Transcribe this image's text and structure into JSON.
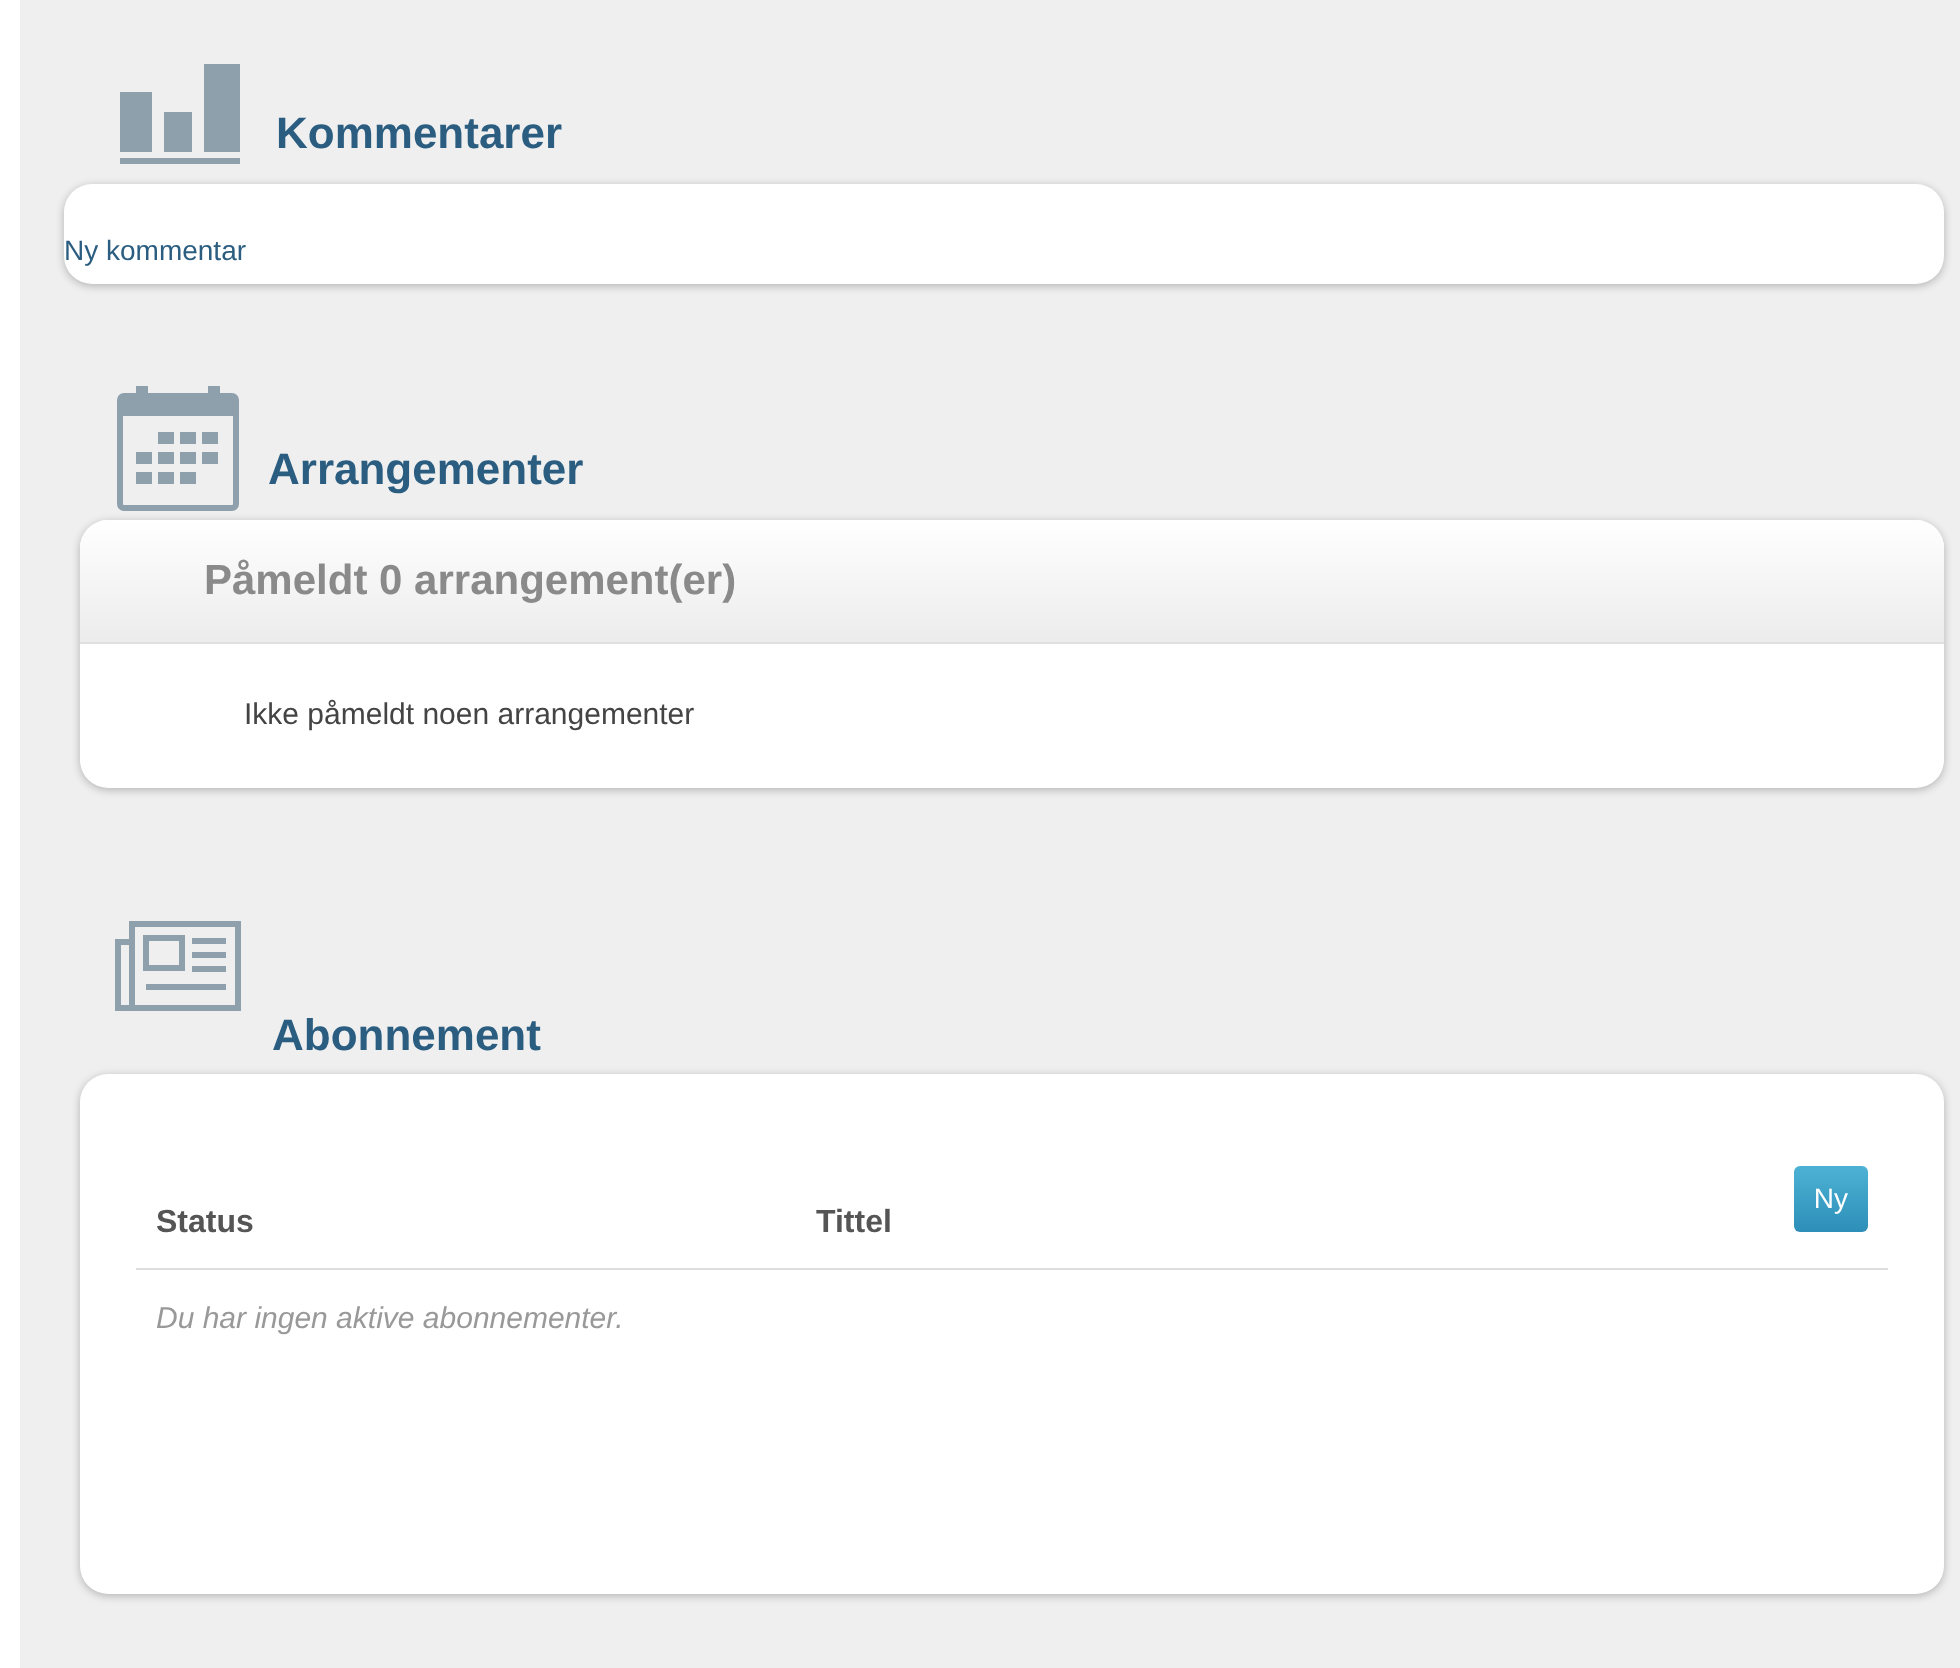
{
  "sections": [
    {
      "kind": "comments",
      "title": "Kommentarer",
      "link": "Ny kommentar"
    },
    {
      "kind": "events",
      "title": "Arrangementer",
      "header": "Påmeldt 0 arrangement(er)",
      "empty": "Ikke påmeldt noen arrangementer"
    },
    {
      "kind": "subscriptions",
      "title": "Abonnement",
      "columns": [
        "Status",
        "Tittel"
      ],
      "button": "Ny",
      "empty": "Du har ingen aktive abonnementer."
    }
  ]
}
